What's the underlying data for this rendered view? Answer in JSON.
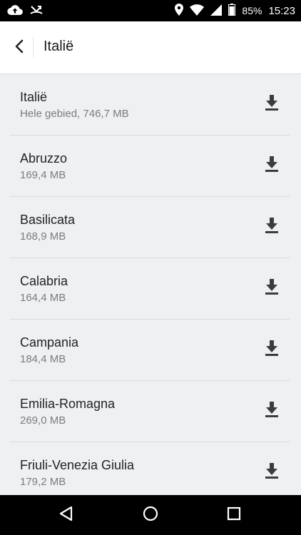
{
  "status_bar": {
    "battery": "85%",
    "time": "15:23",
    "icons": [
      "cloud-upload-icon",
      "missed-call-icon",
      "location-icon",
      "wifi-icon",
      "signal-icon",
      "battery-icon"
    ]
  },
  "app_bar": {
    "title": "Italië",
    "back_icon": "chevron-left-icon"
  },
  "regions": [
    {
      "name": "Italië",
      "size": "Hele gebied, 746,7 MB"
    },
    {
      "name": "Abruzzo",
      "size": "169,4 MB"
    },
    {
      "name": "Basilicata",
      "size": "168,9 MB"
    },
    {
      "name": "Calabria",
      "size": "164,4 MB"
    },
    {
      "name": "Campania",
      "size": "184,4 MB"
    },
    {
      "name": "Emilia-Romagna",
      "size": "269,0 MB"
    },
    {
      "name": "Friuli-Venezia Giulia",
      "size": "179,2 MB"
    }
  ],
  "nav_bar": {
    "icons": [
      "back-triangle-icon",
      "home-circle-icon",
      "recents-square-icon"
    ]
  },
  "colors": {
    "background": "#eef0f2",
    "app_bar": "#ffffff",
    "text_primary": "#222222",
    "text_secondary": "#7a7c7e",
    "icon": "#3a3c3e"
  }
}
